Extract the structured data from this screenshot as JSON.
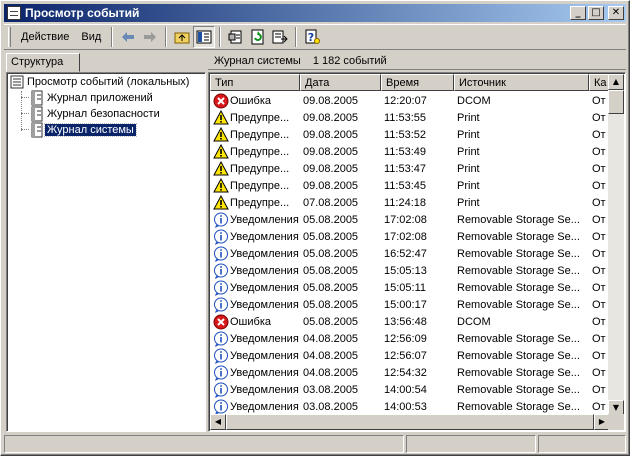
{
  "window": {
    "title": "Просмотр событий"
  },
  "menu": {
    "action": "Действие",
    "view": "Вид"
  },
  "tree": {
    "tab_label": "Структура",
    "root": "Просмотр событий (локальных)",
    "items": [
      {
        "label": "Журнал приложений",
        "selected": false
      },
      {
        "label": "Журнал безопасности",
        "selected": false
      },
      {
        "label": "Журнал системы",
        "selected": true
      }
    ]
  },
  "log": {
    "name": "Журнал системы",
    "count": "1 182 событий"
  },
  "columns": {
    "type": "Тип",
    "date": "Дата",
    "time": "Время",
    "source": "Источник",
    "category": "Ка"
  },
  "events": [
    {
      "icon": "error",
      "type": "Ошибка",
      "date": "09.08.2005",
      "time": "12:20:07",
      "source": "DCOM",
      "category": "От"
    },
    {
      "icon": "warning",
      "type": "Предупре...",
      "date": "09.08.2005",
      "time": "11:53:55",
      "source": "Print",
      "category": "От"
    },
    {
      "icon": "warning",
      "type": "Предупре...",
      "date": "09.08.2005",
      "time": "11:53:52",
      "source": "Print",
      "category": "От"
    },
    {
      "icon": "warning",
      "type": "Предупре...",
      "date": "09.08.2005",
      "time": "11:53:49",
      "source": "Print",
      "category": "От"
    },
    {
      "icon": "warning",
      "type": "Предупре...",
      "date": "09.08.2005",
      "time": "11:53:47",
      "source": "Print",
      "category": "От"
    },
    {
      "icon": "warning",
      "type": "Предупре...",
      "date": "09.08.2005",
      "time": "11:53:45",
      "source": "Print",
      "category": "От"
    },
    {
      "icon": "warning",
      "type": "Предупре...",
      "date": "07.08.2005",
      "time": "11:24:18",
      "source": "Print",
      "category": "От"
    },
    {
      "icon": "info",
      "type": "Уведомления",
      "date": "05.08.2005",
      "time": "17:02:08",
      "source": "Removable Storage Se...",
      "category": "От"
    },
    {
      "icon": "info",
      "type": "Уведомления",
      "date": "05.08.2005",
      "time": "17:02:08",
      "source": "Removable Storage Se...",
      "category": "От"
    },
    {
      "icon": "info",
      "type": "Уведомления",
      "date": "05.08.2005",
      "time": "16:52:47",
      "source": "Removable Storage Se...",
      "category": "От"
    },
    {
      "icon": "info",
      "type": "Уведомления",
      "date": "05.08.2005",
      "time": "15:05:13",
      "source": "Removable Storage Se...",
      "category": "От"
    },
    {
      "icon": "info",
      "type": "Уведомления",
      "date": "05.08.2005",
      "time": "15:05:11",
      "source": "Removable Storage Se...",
      "category": "От"
    },
    {
      "icon": "info",
      "type": "Уведомления",
      "date": "05.08.2005",
      "time": "15:00:17",
      "source": "Removable Storage Se...",
      "category": "От"
    },
    {
      "icon": "error",
      "type": "Ошибка",
      "date": "05.08.2005",
      "time": "13:56:48",
      "source": "DCOM",
      "category": "От"
    },
    {
      "icon": "info",
      "type": "Уведомления",
      "date": "04.08.2005",
      "time": "12:56:09",
      "source": "Removable Storage Se...",
      "category": "От"
    },
    {
      "icon": "info",
      "type": "Уведомления",
      "date": "04.08.2005",
      "time": "12:56:07",
      "source": "Removable Storage Se...",
      "category": "От"
    },
    {
      "icon": "info",
      "type": "Уведомления",
      "date": "04.08.2005",
      "time": "12:54:32",
      "source": "Removable Storage Se...",
      "category": "От"
    },
    {
      "icon": "info",
      "type": "Уведомления",
      "date": "03.08.2005",
      "time": "14:00:54",
      "source": "Removable Storage Se...",
      "category": "От"
    },
    {
      "icon": "info",
      "type": "Уведомления",
      "date": "03.08.2005",
      "time": "14:00:53",
      "source": "Removable Storage Se...",
      "category": "От"
    }
  ],
  "colors": {
    "title_start": "#0a246a",
    "title_end": "#a6caf0",
    "selection": "#0a246a",
    "error": "#d7191c",
    "warning": "#ffe600",
    "info": "#1f4fbf"
  }
}
